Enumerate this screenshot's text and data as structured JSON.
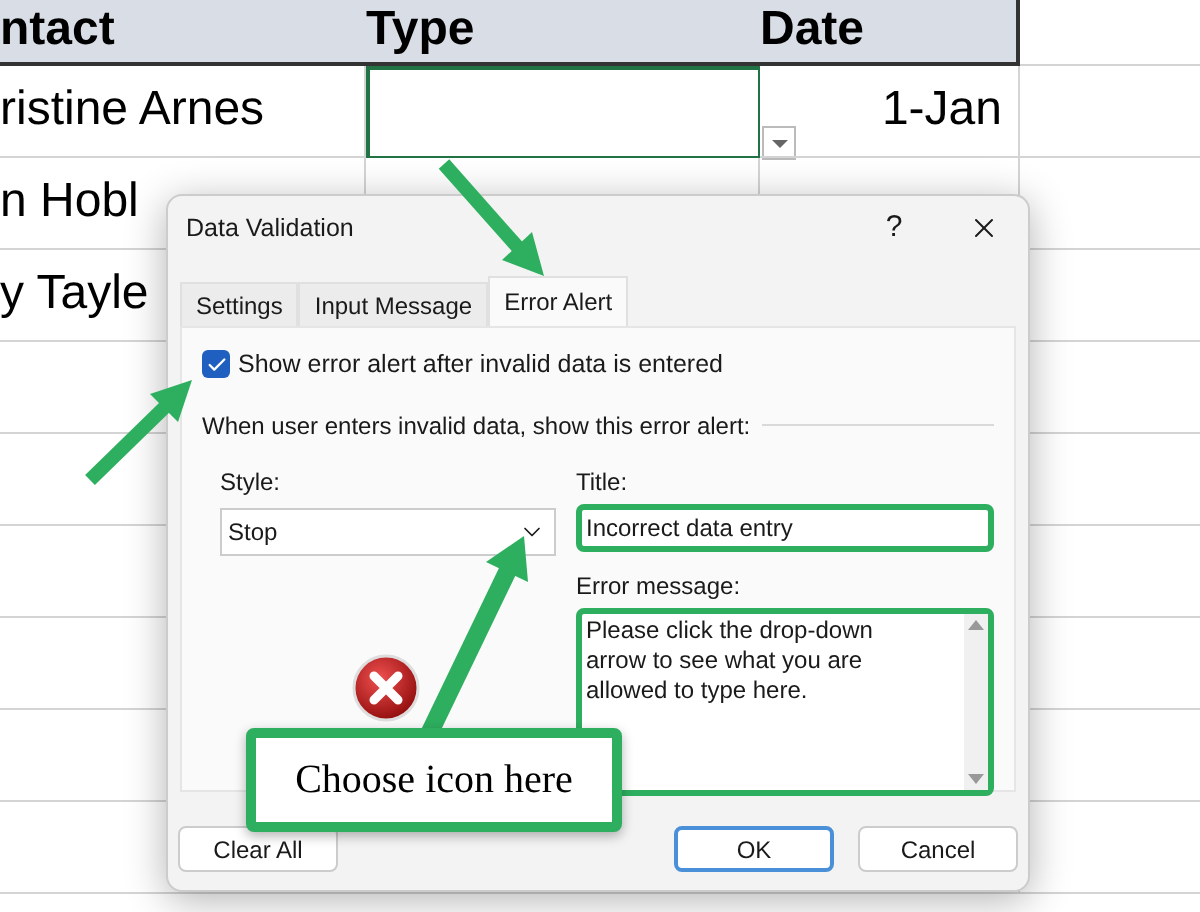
{
  "sheet": {
    "headers": [
      "ntact",
      "Type",
      "Date"
    ],
    "rows": [
      {
        "cells": [
          {
            "text": "ristine Arnes",
            "selected": false
          },
          {
            "text": "",
            "selected": true
          },
          {
            "text": "1-Jan",
            "selected": false
          }
        ]
      },
      {
        "cells": [
          {
            "text": "n Hobl",
            "selected": false
          },
          {
            "text": "",
            "selected": false
          },
          {
            "text": "",
            "selected": false
          }
        ]
      },
      {
        "cells": [
          {
            "text": "y Tayle",
            "selected": false
          }
        ]
      }
    ]
  },
  "dialog": {
    "title": "Data Validation",
    "help": "?",
    "tabs": [
      {
        "label": "Settings",
        "selected": false
      },
      {
        "label": "Input Message",
        "selected": false
      },
      {
        "label": "Error Alert",
        "selected": true
      }
    ],
    "show_alert": {
      "label": "Show error alert after invalid data is entered",
      "checked": true
    },
    "section": "When user enters invalid data, show this error alert:",
    "style": {
      "label": "Style:",
      "value": "Stop"
    },
    "title_field": {
      "label": "Title:",
      "value": "Incorrect data entry"
    },
    "message_field": {
      "label": "Error message:",
      "value": "Please click the drop-down arrow to see what you are allowed to type here."
    },
    "buttons": [
      {
        "label": "Clear All",
        "kind": "secondary"
      },
      {
        "label": "OK",
        "kind": "default"
      },
      {
        "label": "Cancel",
        "kind": "secondary"
      }
    ]
  },
  "callout": "Choose icon here"
}
